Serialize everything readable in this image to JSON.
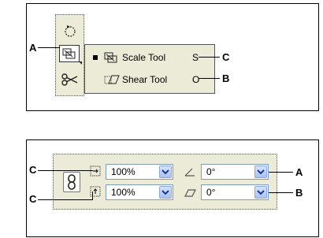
{
  "top_panel": {
    "callouts": {
      "a": "A",
      "b": "B",
      "c": "C"
    },
    "tools": {
      "rotate_icon": "rotate-icon",
      "scale_icon": "scale-tool-icon",
      "scissors_icon": "scissors-icon"
    },
    "flyout": {
      "items": [
        {
          "label": "Scale Tool",
          "key": "S",
          "icon": "scale-tool-icon",
          "selected": true
        },
        {
          "label": "Shear Tool",
          "key": "O",
          "icon": "shear-tool-icon",
          "selected": false
        }
      ]
    }
  },
  "bottom_panel": {
    "callouts": {
      "a": "A",
      "b": "B",
      "c1": "C",
      "c2": "C"
    },
    "scale_x": {
      "value": "100%",
      "icon": "scale-horizontal-icon"
    },
    "scale_y": {
      "value": "100%",
      "icon": "scale-vertical-icon"
    },
    "rotate": {
      "value": "0°",
      "icon": "rotate-angle-icon"
    },
    "shear": {
      "value": "0°",
      "icon": "shear-angle-icon"
    },
    "constrain_icon": "chain-link-icon"
  }
}
